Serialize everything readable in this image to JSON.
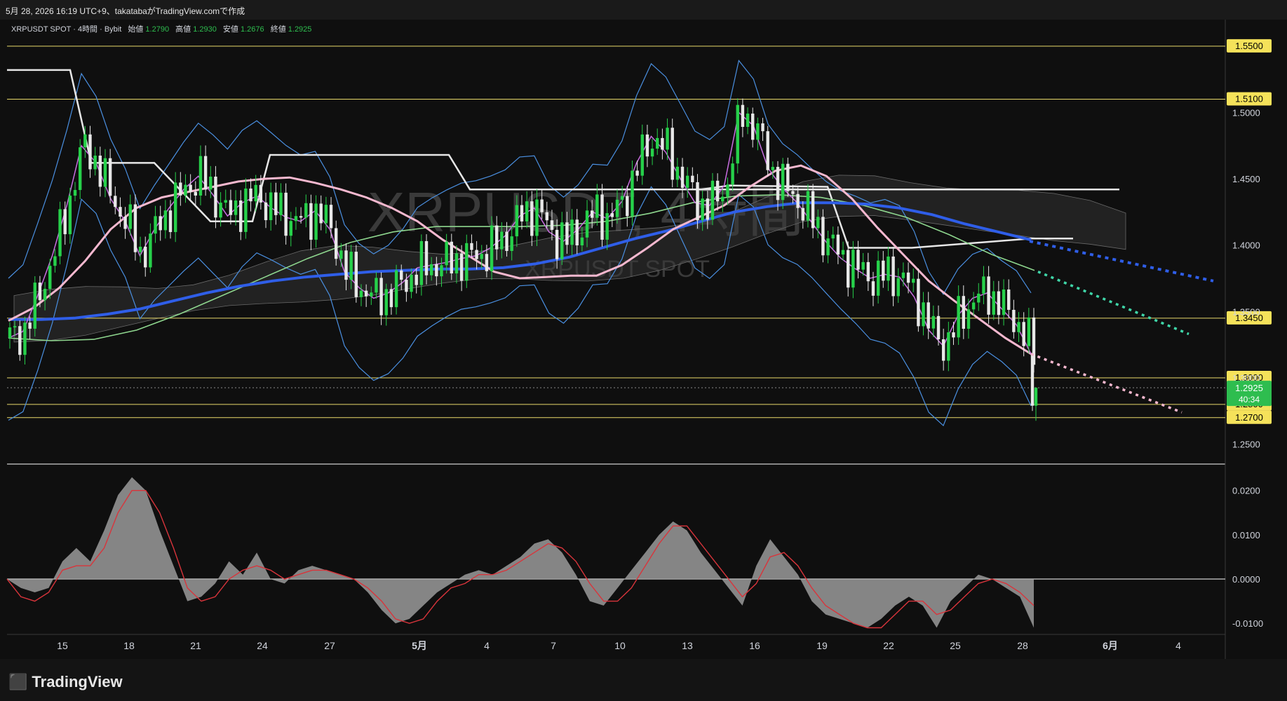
{
  "header": {
    "caption": "5月 28, 2026 16:19 UTC+9、takatabaがTradingView.comで作成"
  },
  "legend": {
    "symbol": "XRPUSDT SPOT · 4時間 · Bybit",
    "open_label": "始値",
    "open": "1.2790",
    "high_label": "高値",
    "high": "1.2930",
    "low_label": "安値",
    "low": "1.2676",
    "close_label": "終値",
    "close": "1.2925"
  },
  "watermark": {
    "line1": "XRPUSDT, 4時間",
    "line2": "XRPUSDT SPOT"
  },
  "footer": {
    "brand": "TradingView"
  },
  "colors": {
    "up": "#26d14a",
    "down": "#e8e8e8",
    "ema_fast": "#c86ee0",
    "ema_mid": "#f5b8cf",
    "ema_slow": "#2f5ee8",
    "ema_long": "#8ed68e",
    "bollinger": "#4a8fe0",
    "donchian": "#e6e6e6",
    "level_line": "#e8d86a",
    "price_badge": "#2ebd4f"
  },
  "chart_data": [
    {
      "type": "line",
      "title": "XRPUSDT SPOT 4時間",
      "x_ticks": [
        "15",
        "18",
        "21",
        "24",
        "27",
        "5月",
        "4",
        "7",
        "10",
        "13",
        "16",
        "19",
        "22",
        "25",
        "28",
        "6月",
        "4"
      ],
      "y_ticks": [
        "1.5000",
        "1.4500",
        "1.4000",
        "1.3500",
        "1.3000",
        "1.2500"
      ],
      "ylim": [
        1.235,
        1.57
      ],
      "horizontal_levels": [
        "1.5500",
        "1.5100",
        "1.3450",
        "1.3000",
        "1.2800",
        "1.2700"
      ],
      "last_price": "1.2925",
      "countdown": "40:34",
      "grid": false,
      "series": [
        {
          "values": [
            1.33,
            1.335,
            1.362,
            1.392,
            1.43,
            1.475,
            1.462,
            1.435,
            1.418,
            1.392,
            1.412,
            1.428,
            1.442,
            1.452,
            1.438,
            1.422,
            1.432,
            1.437,
            1.428,
            1.421,
            1.418,
            1.426,
            1.412,
            1.38,
            1.368,
            1.36,
            1.364,
            1.372,
            1.383,
            1.385,
            1.387,
            1.39,
            1.392,
            1.398,
            1.407,
            1.422,
            1.428,
            1.41,
            1.403,
            1.412,
            1.425,
            1.42,
            1.433,
            1.462,
            1.482,
            1.47,
            1.45,
            1.432,
            1.43,
            1.445,
            1.5,
            1.49,
            1.458,
            1.443,
            1.432,
            1.417,
            1.402,
            1.39,
            1.382,
            1.375,
            1.378,
            1.376,
            1.361,
            1.336,
            1.324,
            1.347,
            1.36,
            1.364,
            1.352,
            1.34,
            1.318
          ]
        },
        {
          "values": [
            1.343,
            1.353,
            1.368,
            1.388,
            1.412,
            1.428,
            1.436,
            1.44,
            1.444,
            1.448,
            1.45,
            1.451,
            1.447,
            1.442,
            1.436,
            1.428,
            1.418,
            1.404,
            1.392,
            1.38,
            1.375,
            1.376,
            1.377,
            1.377,
            1.385,
            1.398,
            1.412,
            1.421,
            1.43,
            1.444,
            1.456,
            1.46,
            1.452,
            1.435,
            1.413,
            1.393,
            1.373,
            1.358,
            1.344,
            1.33,
            1.318
          ]
        },
        {
          "values": [
            1.344,
            1.344,
            1.345,
            1.348,
            1.352,
            1.358,
            1.364,
            1.369,
            1.373,
            1.376,
            1.378,
            1.38,
            1.381,
            1.382,
            1.382,
            1.383,
            1.386,
            1.391,
            1.398,
            1.405,
            1.411,
            1.418,
            1.425,
            1.429,
            1.432,
            1.432,
            1.431,
            1.428,
            1.423,
            1.416,
            1.41,
            1.404
          ]
        },
        {
          "values": [
            1.33,
            1.328,
            1.329,
            1.336,
            1.348,
            1.362,
            1.376,
            1.39,
            1.402,
            1.41,
            1.414,
            1.414,
            1.414,
            1.415,
            1.418,
            1.424,
            1.432,
            1.437,
            1.438,
            1.436,
            1.43,
            1.421,
            1.408,
            1.393,
            1.381
          ]
        }
      ]
    },
    {
      "type": "area",
      "title": "",
      "y_ticks": [
        "0.0200",
        "0.0100",
        "0.0000",
        "-0.0100"
      ],
      "ylim": [
        -0.0125,
        0.0255
      ],
      "series": [
        {
          "values": [
            0.0,
            -0.002,
            -0.003,
            -0.002,
            0.004,
            0.007,
            0.004,
            0.011,
            0.019,
            0.023,
            0.02,
            0.011,
            0.003,
            -0.005,
            -0.004,
            -0.001,
            0.004,
            0.001,
            0.006,
            0.0,
            -0.001,
            0.002,
            0.003,
            0.002,
            0.001,
            0.0,
            -0.003,
            -0.007,
            -0.01,
            -0.009,
            -0.006,
            -0.003,
            -0.001,
            0.001,
            0.002,
            0.001,
            0.003,
            0.005,
            0.008,
            0.009,
            0.006,
            0.001,
            -0.005,
            -0.006,
            -0.002,
            0.002,
            0.006,
            0.01,
            0.013,
            0.011,
            0.006,
            0.002,
            -0.002,
            -0.006,
            0.003,
            0.009,
            0.005,
            0.001,
            -0.005,
            -0.008,
            -0.009,
            -0.01,
            -0.011,
            -0.009,
            -0.006,
            -0.004,
            -0.006,
            -0.011,
            -0.005,
            -0.002,
            0.001,
            0.0,
            -0.002,
            -0.004,
            -0.011
          ]
        },
        {
          "values": [
            0.0,
            -0.004,
            -0.005,
            -0.003,
            0.002,
            0.003,
            0.003,
            0.007,
            0.015,
            0.02,
            0.02,
            0.015,
            0.007,
            -0.002,
            -0.005,
            -0.004,
            0.0,
            0.002,
            0.003,
            0.002,
            0.0,
            0.001,
            0.002,
            0.002,
            0.001,
            0.0,
            -0.002,
            -0.005,
            -0.009,
            -0.01,
            -0.009,
            -0.005,
            -0.002,
            -0.001,
            0.001,
            0.001,
            0.002,
            0.004,
            0.006,
            0.008,
            0.007,
            0.004,
            -0.001,
            -0.005,
            -0.005,
            -0.002,
            0.003,
            0.008,
            0.012,
            0.012,
            0.008,
            0.004,
            0.0,
            -0.004,
            -0.001,
            0.005,
            0.006,
            0.003,
            -0.002,
            -0.006,
            -0.008,
            -0.01,
            -0.011,
            -0.011,
            -0.008,
            -0.005,
            -0.005,
            -0.008,
            -0.007,
            -0.004,
            -0.001,
            0.0,
            -0.001,
            -0.003,
            -0.006
          ]
        }
      ]
    }
  ]
}
